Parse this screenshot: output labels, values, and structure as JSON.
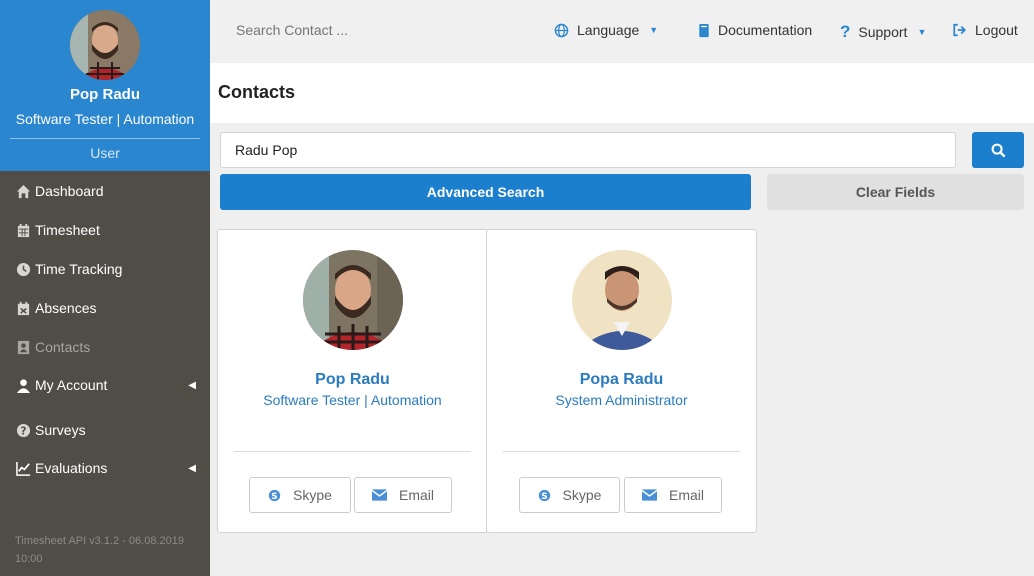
{
  "sidebar": {
    "profile": {
      "name": "Pop Radu",
      "title": "Software Tester | Automation",
      "role": "User"
    },
    "nav": [
      {
        "label": "Dashboard",
        "icon": "home-icon",
        "disabled": false
      },
      {
        "label": "Timesheet",
        "icon": "calendar-icon",
        "disabled": false
      },
      {
        "label": "Time Tracking",
        "icon": "clock-icon",
        "disabled": false
      },
      {
        "label": "Absences",
        "icon": "calendar-x-icon",
        "disabled": false
      },
      {
        "label": "Contacts",
        "icon": "contact-card-icon",
        "disabled": true
      },
      {
        "label": "My Account",
        "icon": "user-icon",
        "disabled": false,
        "expandable": true
      },
      {
        "label": "Surveys",
        "icon": "question-circle-icon",
        "disabled": false
      },
      {
        "label": "Evaluations",
        "icon": "line-chart-icon",
        "disabled": false,
        "expandable": true
      }
    ],
    "version": "Timesheet API v3.1.2 - 06.08.2019 10:00"
  },
  "topbar": {
    "search_placeholder": "Search Contact ...",
    "language": "Language",
    "documentation": "Documentation",
    "support": "Support",
    "logout": "Logout"
  },
  "page": {
    "title": "Contacts"
  },
  "search": {
    "value": "Radu Pop",
    "advanced_label": "Advanced Search",
    "clear_label": "Clear Fields"
  },
  "contacts": [
    {
      "name": "Pop Radu",
      "title": "Software Tester | Automation",
      "skype_label": "Skype",
      "email_label": "Email"
    },
    {
      "name": "Popa Radu",
      "title": "System Administrator",
      "skype_label": "Skype",
      "email_label": "Email"
    }
  ],
  "colors": {
    "accent": "#2a86cf",
    "sidebar": "#504d47",
    "link": "#2a7bc0"
  }
}
